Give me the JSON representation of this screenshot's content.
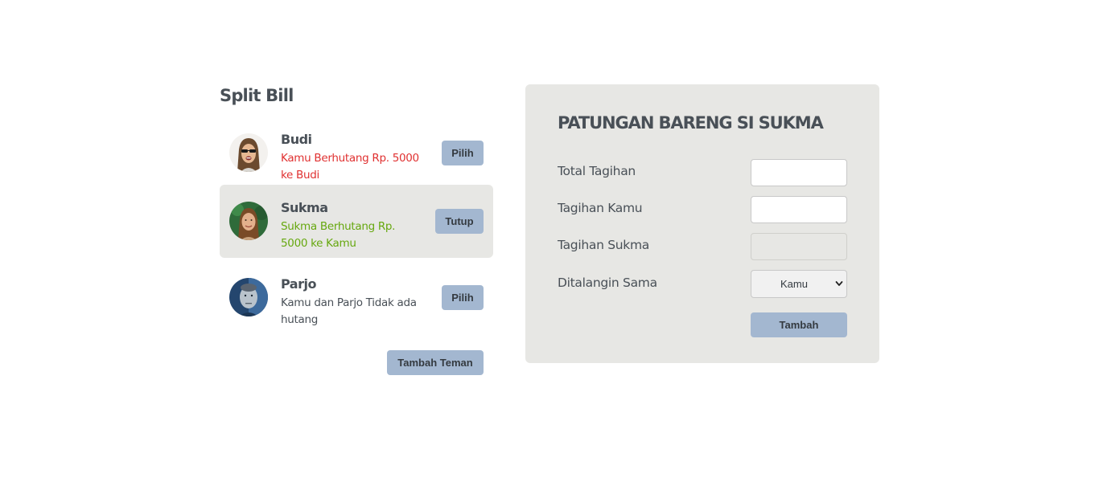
{
  "app": {
    "title": "Split Bill",
    "add_friend_label": "Tambah Teman"
  },
  "friends": [
    {
      "name": "Budi",
      "status": "Kamu Berhutang Rp. 5000 ke Budi",
      "status_color": "#e03131",
      "button": "Pilih",
      "selected": false,
      "avatar_icon": "person-sunglasses-avatar"
    },
    {
      "name": "Sukma",
      "status": "Sukma Berhutang Rp. 5000 ke Kamu",
      "status_color": "#66a80f",
      "button": "Tutup",
      "selected": true,
      "avatar_icon": "person-woman-avatar"
    },
    {
      "name": "Parjo",
      "status": "Kamu dan Parjo Tidak ada hutang",
      "status_color": "#495057",
      "button": "Pilih",
      "selected": false,
      "avatar_icon": "person-man-avatar"
    }
  ],
  "form": {
    "title": "PATUNGAN BARENG SI SUKMA",
    "total_label": "Total Tagihan",
    "total_value": "",
    "yours_label": "Tagihan Kamu",
    "yours_value": "",
    "friend_label": "Tagihan Sukma",
    "friend_value": "",
    "payer_label": "Ditalangin Sama",
    "payer_selected": "Kamu",
    "submit_label": "Tambah"
  },
  "colors": {
    "accent": "#a3b7d0",
    "panel": "#e7e7e4",
    "owe": "#e03131",
    "owed": "#66a80f",
    "text": "#495057"
  }
}
